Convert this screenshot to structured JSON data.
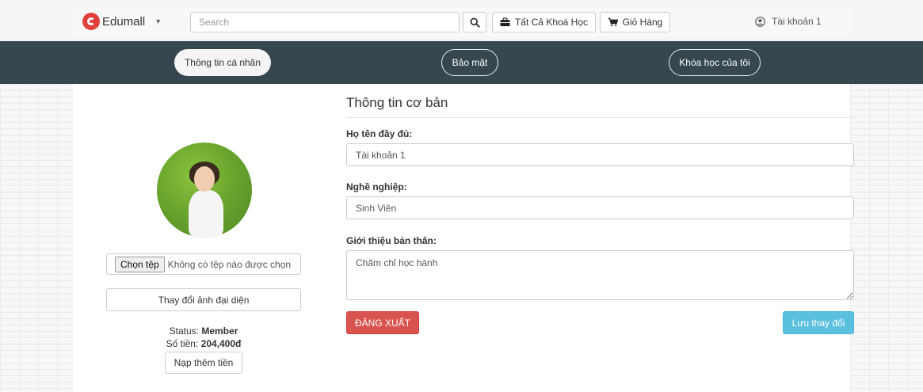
{
  "header": {
    "brand": "Edumall",
    "search_placeholder": "Search",
    "all_courses_label": "Tất Cả Khoá Học",
    "cart_label": "Giỏ Hàng",
    "account_label": "Tài khoản 1"
  },
  "profile_tabs": {
    "info": "Thông tin cá nhân",
    "security": "Bảo mật",
    "my_courses": "Khóa học của tôi"
  },
  "sidebar": {
    "file_button": "Chọn tệp",
    "file_status": "Không có tệp nào được chọn",
    "change_avatar": "Thay đổi ảnh đại diện",
    "status_label": "Status:",
    "status_value": "Member",
    "balance_label": "Số tiền:",
    "balance_value": "204,400đ",
    "topup_label": "Nạp thêm tiền"
  },
  "form": {
    "section_title": "Thông tin cơ bản",
    "fullname_label": "Họ tên đầy đủ:",
    "fullname_value": "Tài khoản 1",
    "job_label": "Nghề nghiệp:",
    "job_value": "Sinh Viên",
    "bio_label": "Giới thiệu bản thân:",
    "bio_value": "Chăm chỉ học hành",
    "logout_label": "ĐĂNG XUẤT",
    "save_label": "Lưu thay đổi"
  },
  "colors": {
    "band": "#36474f",
    "danger": "#d9534f",
    "info": "#5bc0de",
    "brand": "#e0403a"
  }
}
